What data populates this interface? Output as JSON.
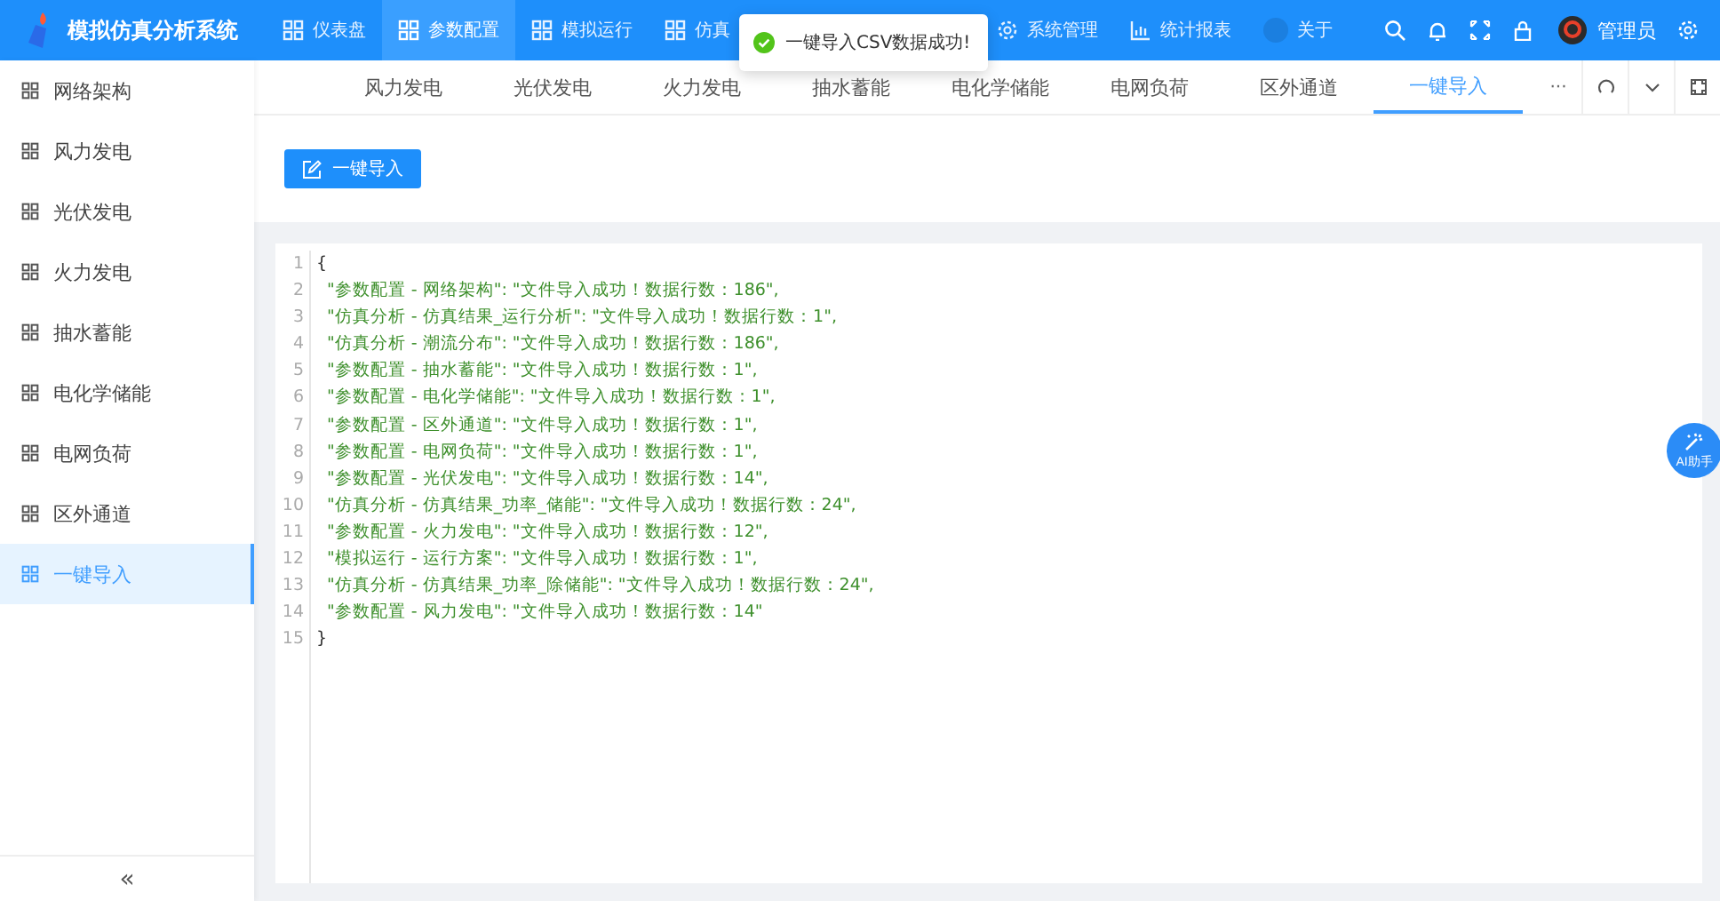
{
  "app": {
    "title": "模拟仿真分析系统"
  },
  "top_nav": [
    {
      "label": "仪表盘",
      "selected": false
    },
    {
      "label": "参数配置",
      "selected": true
    },
    {
      "label": "模拟运行",
      "selected": false
    },
    {
      "label": "仿真",
      "selected": false
    },
    {
      "label": "系统管理",
      "selected": false
    },
    {
      "label": "统计报表",
      "selected": false
    },
    {
      "label": "关于",
      "selected": false
    }
  ],
  "user": {
    "name": "管理员"
  },
  "toast": {
    "message": "一键导入CSV数据成功!"
  },
  "sidebar": {
    "items": [
      {
        "label": "网络架构",
        "selected": false
      },
      {
        "label": "风力发电",
        "selected": false
      },
      {
        "label": "光伏发电",
        "selected": false
      },
      {
        "label": "火力发电",
        "selected": false
      },
      {
        "label": "抽水蓄能",
        "selected": false
      },
      {
        "label": "电化学储能",
        "selected": false
      },
      {
        "label": "电网负荷",
        "selected": false
      },
      {
        "label": "区外通道",
        "selected": false
      },
      {
        "label": "一键导入",
        "selected": true
      }
    ],
    "collapse": "«"
  },
  "tabs": [
    {
      "label": "风力发电",
      "selected": false
    },
    {
      "label": "光伏发电",
      "selected": false
    },
    {
      "label": "火力发电",
      "selected": false
    },
    {
      "label": "抽水蓄能",
      "selected": false
    },
    {
      "label": "电化学储能",
      "selected": false
    },
    {
      "label": "电网负荷",
      "selected": false
    },
    {
      "label": "区外通道",
      "selected": false
    },
    {
      "label": "一键导入",
      "selected": true
    }
  ],
  "tab_more": "···",
  "import_button": {
    "label": "一键导入"
  },
  "ai_helper": {
    "label": "AI助手"
  },
  "code": [
    {
      "number": "1",
      "kind": "brace",
      "text": "{"
    },
    {
      "number": "2",
      "kind": "entry",
      "text": "\"参数配置 - 网络架构\": \"文件导入成功！数据行数：186\","
    },
    {
      "number": "3",
      "kind": "entry",
      "text": "\"仿真分析 - 仿真结果_运行分析\": \"文件导入成功！数据行数：1\","
    },
    {
      "number": "4",
      "kind": "entry",
      "text": "\"仿真分析 - 潮流分布\": \"文件导入成功！数据行数：186\","
    },
    {
      "number": "5",
      "kind": "entry",
      "text": "\"参数配置 - 抽水蓄能\": \"文件导入成功！数据行数：1\","
    },
    {
      "number": "6",
      "kind": "entry",
      "text": "\"参数配置 - 电化学储能\": \"文件导入成功！数据行数：1\","
    },
    {
      "number": "7",
      "kind": "entry",
      "text": "\"参数配置 - 区外通道\": \"文件导入成功！数据行数：1\","
    },
    {
      "number": "8",
      "kind": "entry",
      "text": "\"参数配置 - 电网负荷\": \"文件导入成功！数据行数：1\","
    },
    {
      "number": "9",
      "kind": "entry",
      "text": "\"参数配置 - 光伏发电\": \"文件导入成功！数据行数：14\","
    },
    {
      "number": "10",
      "kind": "entry",
      "text": "\"仿真分析 - 仿真结果_功率_储能\": \"文件导入成功！数据行数：24\","
    },
    {
      "number": "11",
      "kind": "entry",
      "text": "\"参数配置 - 火力发电\": \"文件导入成功！数据行数：12\","
    },
    {
      "number": "12",
      "kind": "entry",
      "text": "\"模拟运行 - 运行方案\": \"文件导入成功！数据行数：1\","
    },
    {
      "number": "13",
      "kind": "entry",
      "text": "\"仿真分析 - 仿真结果_功率_除储能\": \"文件导入成功！数据行数：24\","
    },
    {
      "number": "14",
      "kind": "entry",
      "text": "\"参数配置 - 风力发电\": \"文件导入成功！数据行数：14\""
    },
    {
      "number": "15",
      "kind": "brace",
      "text": "}"
    }
  ]
}
